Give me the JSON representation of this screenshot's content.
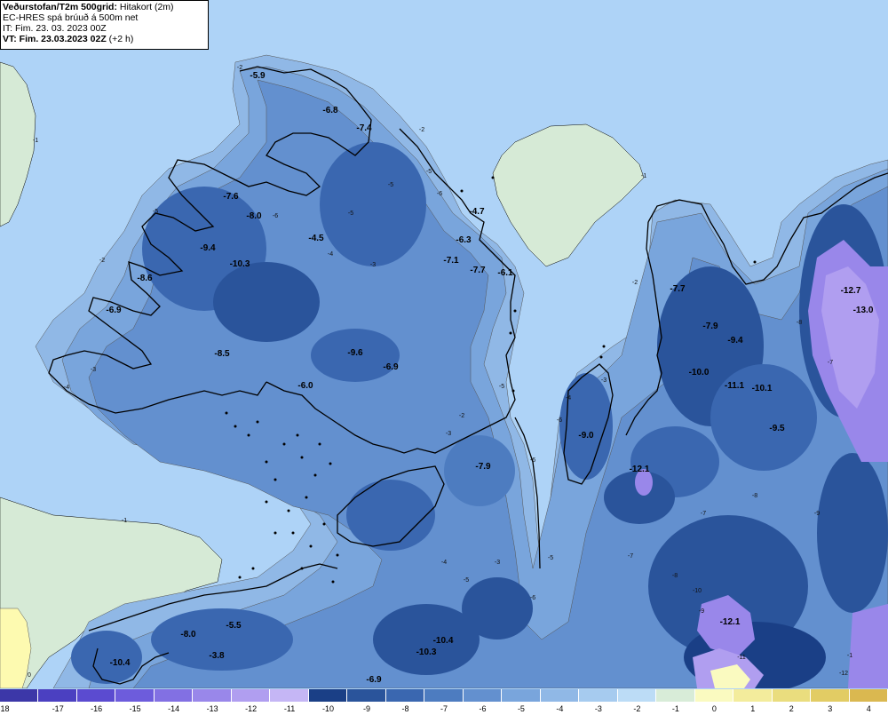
{
  "header": {
    "title_bold": "Veðurstofan/T2m 500grid:",
    "title_rest": " Hitakort (2m)",
    "model": "EC-HRES spá brúuð á 500m net",
    "issue_time": "IT: Fim. 23. 03. 2023 00Z",
    "valid_bold": "VT: Fim. 23.03.2023 02Z",
    "valid_rest": " (+2 h)"
  },
  "colors": {
    "sea": "#aed3f7",
    "neighbor_land": "#d6ead6",
    "neighbor_warm": "#fdfab0",
    "coast": "#000000"
  },
  "temperature_labels": [
    "-5.9",
    "-6.8",
    "-7.4",
    "-7.6",
    "-8.0",
    "-9.4",
    "-10.3",
    "-4.5",
    "-8.6",
    "-6.9",
    "-8.5",
    "-6.0",
    "-9.6",
    "-6.9",
    "-6.3",
    "-4.7",
    "-7.1",
    "-7.7",
    "-6.1",
    "-7.7",
    "-7.9",
    "-9.4",
    "-10.0",
    "-11.1",
    "-10.1",
    "-12.7",
    "-13.0",
    "-9.5",
    "-9.0",
    "-12.1",
    "-7.9",
    "-8.0",
    "-5.5",
    "-3.8",
    "-10.4",
    "-10.4",
    "-10.3",
    "-6.9",
    "-12.1"
  ],
  "contour_labels": [
    "-2",
    "-1",
    "-2",
    "-2",
    "-1",
    "-2",
    "-3",
    "-4",
    "-5",
    "-6",
    "-5",
    "-4",
    "-3",
    "-5",
    "-6",
    "-5",
    "-1",
    "-2",
    "-3",
    "-5",
    "-6",
    "-7",
    "-8",
    "-9",
    "-10",
    "-11",
    "-12",
    "-8",
    "-6",
    "-7",
    "-5",
    "-4",
    "-3",
    "-3",
    "-4",
    "-5",
    "-6",
    "-8",
    "-9",
    "-7",
    "0",
    "-1"
  ],
  "legend": {
    "ticks": [
      "-18",
      "-17",
      "-16",
      "-15",
      "-14",
      "-13",
      "-12",
      "-11",
      "-10",
      "-9",
      "-8",
      "-7",
      "-6",
      "-5",
      "-4",
      "-3",
      "-2",
      "-1",
      "0",
      "1",
      "2",
      "3",
      "4"
    ],
    "colors": [
      "#3c37a8",
      "#4b40c1",
      "#5b4bd0",
      "#6d5cdc",
      "#8270e3",
      "#9987ea",
      "#b09ef0",
      "#c5b6f5",
      "#1a3f86",
      "#2a549b",
      "#3a67b0",
      "#4d7cc0",
      "#6390cf",
      "#79a5dc",
      "#90b8e6",
      "#a6cbef",
      "#bcdcf6",
      "#d8ecd8",
      "#fafac0",
      "#f3ec9c",
      "#eadd7e",
      "#e2cc64",
      "#dab850"
    ]
  }
}
